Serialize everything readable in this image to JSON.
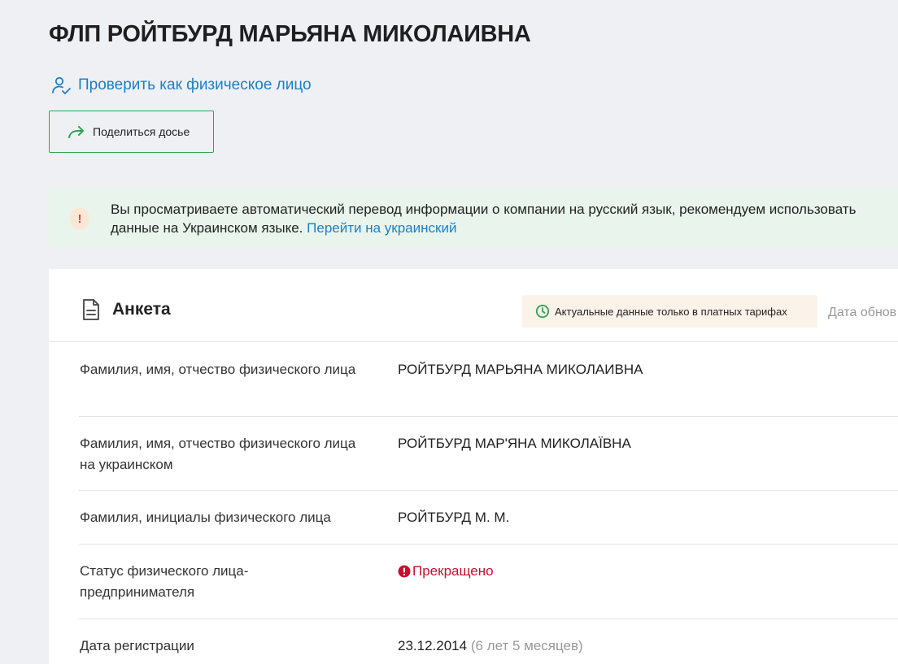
{
  "header": {
    "title": "ФЛП РОЙТБУРД МАРЬЯНА МИКОЛАИВНА",
    "check_link": "Проверить как физическое лицо",
    "share_button": "Поделиться досье"
  },
  "notice": {
    "line1": "Вы просматриваете автоматический перевод информации о компании на русский язык, рекомендуем использовать",
    "line2": "данные на Украинском языке.",
    "link": "Перейти на украинский",
    "icon": "!"
  },
  "card": {
    "title": "Анкета",
    "tariff_badge": "Актуальные данные только в платных тарифах",
    "update_date": "Дата обнов",
    "rows": [
      {
        "label": "Фамилия, имя, отчество физического лица",
        "value": "РОЙТБУРД МАРЬЯНА МИКОЛАИВНА"
      },
      {
        "label": "Фамилия, имя, отчество физического лица на украинском",
        "value": "РОЙТБУРД МАР'ЯНА МИКОЛАЇВНА"
      },
      {
        "label": "Фамилия, инициалы физического лица",
        "value": "РОЙТБУРД М. М."
      },
      {
        "label": "Статус физического лица-предпринимателя",
        "value": "Прекращено"
      },
      {
        "label": "Дата регистрации",
        "value": "23.12.2014",
        "extra": "(6 лет 5 месяцев)"
      }
    ]
  },
  "colors": {
    "accent_link": "#1c7fc4",
    "accent_green": "#2fa34f",
    "status_terminated": "#c8102e",
    "notice_bg": "#e9f5ec",
    "page_bg": "#eff0f4"
  }
}
